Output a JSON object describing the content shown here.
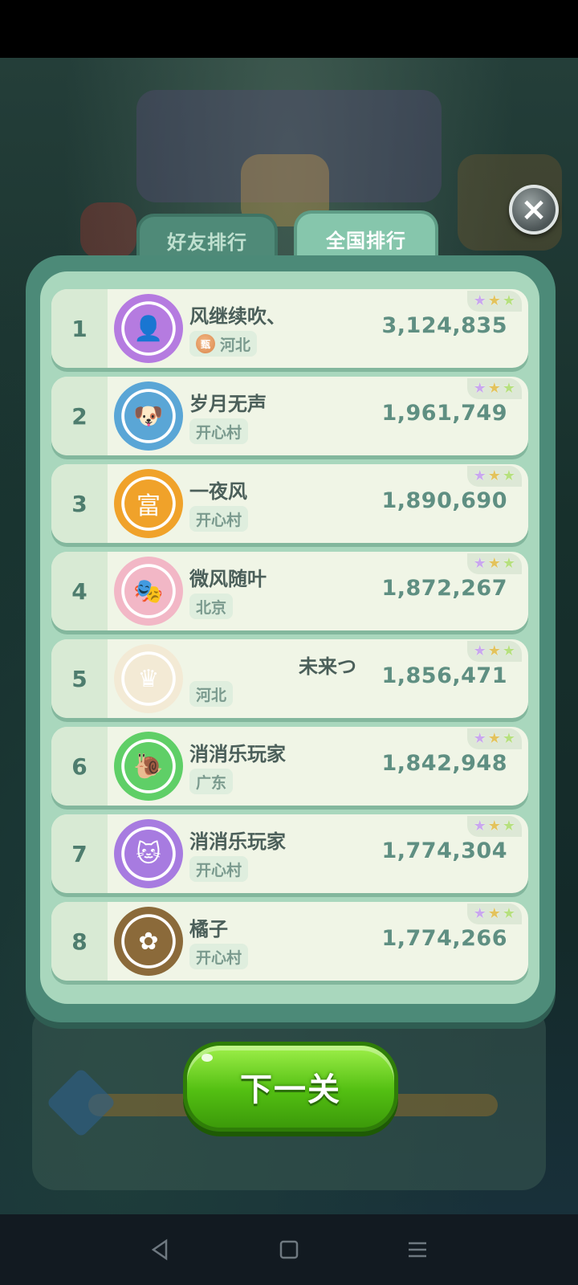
{
  "tabs": [
    {
      "label": "好友排行",
      "active": false
    },
    {
      "label": "全国排行",
      "active": true
    }
  ],
  "close": {
    "glyph": "×",
    "icon": "close-icon"
  },
  "leaderboard": [
    {
      "rank": "1",
      "name": "风继续吹、",
      "region": "河北",
      "region_badge": "甄",
      "score": "3,124,835",
      "avatar": {
        "icon": "photo-avatar-purple-frame",
        "color": "#b57be0",
        "glyph": "👤"
      }
    },
    {
      "rank": "2",
      "name": "岁月无声",
      "region": "开心村",
      "score": "1,961,749",
      "avatar": {
        "icon": "white-dog-avatar",
        "color": "#5aa6d6",
        "glyph": "🐶"
      }
    },
    {
      "rank": "3",
      "name": "一夜风",
      "region": "开心村",
      "score": "1,890,690",
      "avatar": {
        "icon": "fortune-avatar",
        "color": "#f0a22a",
        "glyph": "富"
      }
    },
    {
      "rank": "4",
      "name": "微风随叶",
      "region": "北京",
      "score": "1,872,267",
      "avatar": {
        "icon": "opera-mask-avatar",
        "color": "#f2b7c6",
        "glyph": "🎭"
      }
    },
    {
      "rank": "5",
      "name": "未来つ",
      "region": "河北",
      "score": "1,856,471",
      "avatar": {
        "icon": "crown-avatar",
        "color": "#f3ead5",
        "glyph": "♛"
      }
    },
    {
      "rank": "6",
      "name": "消消乐玩家",
      "region": "广东",
      "score": "1,842,948",
      "avatar": {
        "icon": "snail-avatar",
        "color": "#5fcf67",
        "glyph": "🐌"
      }
    },
    {
      "rank": "7",
      "name": "消消乐玩家",
      "region": "开心村",
      "score": "1,774,304",
      "avatar": {
        "icon": "blue-cat-avatar",
        "color": "#a77be0",
        "glyph": "🐱"
      }
    },
    {
      "rank": "8",
      "name": "橘子",
      "region": "开心村",
      "score": "1,774,266",
      "avatar": {
        "icon": "flower-avatar",
        "color": "#8b6a3a",
        "glyph": "✿"
      }
    }
  ],
  "next_button": {
    "label": "下一关"
  },
  "nav": [
    {
      "name": "back-icon",
      "glyph": "◁"
    },
    {
      "name": "home-icon",
      "glyph": "▢"
    },
    {
      "name": "menu-icon",
      "glyph": "☰"
    }
  ]
}
